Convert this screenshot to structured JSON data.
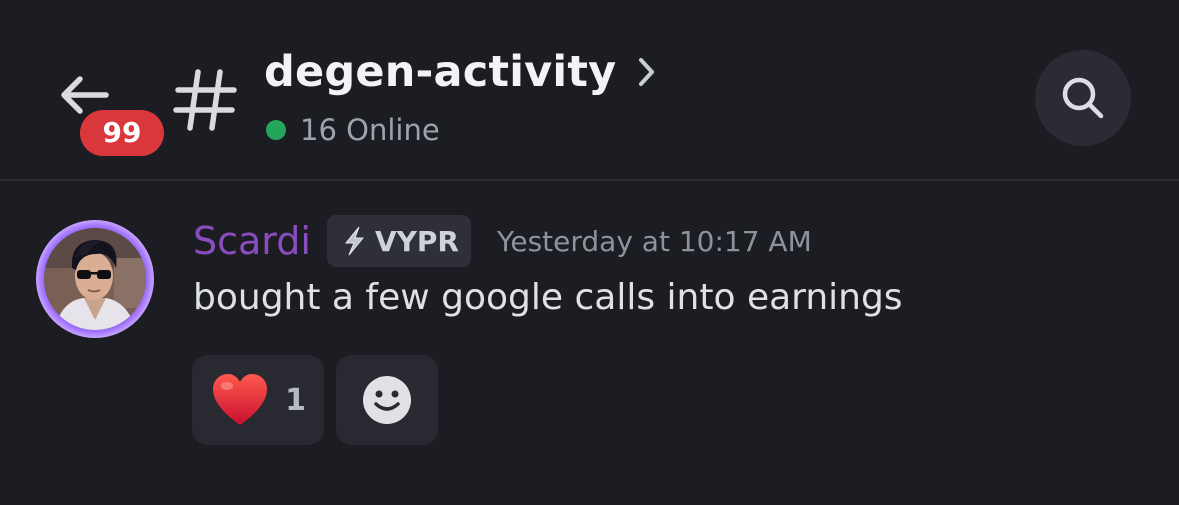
{
  "header": {
    "unread_count": "99",
    "channel_name": "degen-activity",
    "online_text": "16 Online"
  },
  "message": {
    "author": "Scardi",
    "guild_tag": "VYPR",
    "timestamp": "Yesterday at 10:17 AM",
    "text": "bought a few google calls into earnings",
    "reactions": [
      {
        "emoji": "heart",
        "count": "1"
      }
    ]
  },
  "colors": {
    "background": "#1c1d23",
    "unread_badge": "#da373c",
    "online_dot": "#23a55a",
    "author_name": "#8a4dbf"
  },
  "icons": [
    "back-arrow-icon",
    "hash-icon",
    "chevron-right-icon",
    "search-icon",
    "bolt-icon",
    "heart-icon",
    "smiley-face-icon"
  ]
}
